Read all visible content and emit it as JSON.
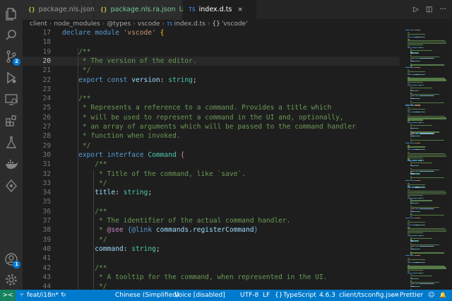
{
  "tabs": [
    {
      "icon": "{}",
      "label": "package.nls.json",
      "status": "",
      "active": false
    },
    {
      "icon": "{}",
      "label": "package.nls.ra.json",
      "status": "U",
      "active": false
    },
    {
      "icon": "TS",
      "label": "index.d.ts",
      "status": "",
      "active": true
    }
  ],
  "tab_actions": {
    "run": "▷",
    "split": "◫",
    "more": "···",
    "close": "×"
  },
  "breadcrumb": {
    "items": [
      "client",
      "node_modules",
      "@types",
      "vscode"
    ],
    "file_icon": "TS",
    "file": "index.d.ts",
    "symbol_icon": "{}",
    "symbol": "'vscode'"
  },
  "activity_bar": {
    "items": [
      {
        "icon": "files-icon"
      },
      {
        "icon": "search-icon"
      },
      {
        "icon": "source-control-icon",
        "badge": "2"
      },
      {
        "icon": "run-debug-icon"
      },
      {
        "icon": "remote-explorer-icon"
      },
      {
        "icon": "extensions-icon"
      },
      {
        "icon": "testing-icon"
      },
      {
        "icon": "docker-icon"
      },
      {
        "icon": "gitlens-icon"
      }
    ],
    "bottom": [
      {
        "icon": "account-icon",
        "badge": "1"
      },
      {
        "icon": "settings-gear-icon"
      }
    ]
  },
  "editor": {
    "current_line": "20",
    "lines": [
      {
        "n": "17",
        "tokens": [
          [
            "kw",
            "declare"
          ],
          [
            "pl",
            " "
          ],
          [
            "kw",
            "module"
          ],
          [
            "pl",
            " "
          ],
          [
            "str",
            "'vscode'"
          ],
          [
            "pl",
            " "
          ],
          [
            "br1",
            "{"
          ]
        ]
      },
      {
        "n": "18",
        "tokens": []
      },
      {
        "n": "19",
        "tokens": [
          [
            "pl",
            "    "
          ],
          [
            "cm",
            "/**"
          ]
        ]
      },
      {
        "n": "20",
        "tokens": [
          [
            "pl",
            "    "
          ],
          [
            "cm",
            " * The version of the editor."
          ]
        ]
      },
      {
        "n": "21",
        "tokens": [
          [
            "pl",
            "    "
          ],
          [
            "cm",
            " */"
          ]
        ]
      },
      {
        "n": "22",
        "tokens": [
          [
            "pl",
            "    "
          ],
          [
            "kw",
            "export"
          ],
          [
            "pl",
            " "
          ],
          [
            "kw",
            "const"
          ],
          [
            "pl",
            " "
          ],
          [
            "var",
            "version"
          ],
          [
            "pl",
            ": "
          ],
          [
            "ty",
            "string"
          ],
          [
            "pl",
            ";"
          ]
        ]
      },
      {
        "n": "23",
        "tokens": []
      },
      {
        "n": "24",
        "tokens": [
          [
            "pl",
            "    "
          ],
          [
            "cm",
            "/**"
          ]
        ]
      },
      {
        "n": "25",
        "tokens": [
          [
            "pl",
            "    "
          ],
          [
            "cm",
            " * Represents a reference to a command. Provides a title which"
          ]
        ]
      },
      {
        "n": "26",
        "tokens": [
          [
            "pl",
            "    "
          ],
          [
            "cm",
            " * will be used to represent a command in the UI and, optionally,"
          ]
        ]
      },
      {
        "n": "27",
        "tokens": [
          [
            "pl",
            "    "
          ],
          [
            "cm",
            " * an array of arguments which will be passed to the command handler"
          ]
        ]
      },
      {
        "n": "28",
        "tokens": [
          [
            "pl",
            "    "
          ],
          [
            "cm",
            " * function when invoked."
          ]
        ]
      },
      {
        "n": "29",
        "tokens": [
          [
            "pl",
            "    "
          ],
          [
            "cm",
            " */"
          ]
        ]
      },
      {
        "n": "30",
        "tokens": [
          [
            "pl",
            "    "
          ],
          [
            "kw",
            "export"
          ],
          [
            "pl",
            " "
          ],
          [
            "kw",
            "interface"
          ],
          [
            "pl",
            " "
          ],
          [
            "ty",
            "Command"
          ],
          [
            "pl",
            " "
          ],
          [
            "kw2",
            "{"
          ]
        ]
      },
      {
        "n": "31",
        "tokens": [
          [
            "pl",
            "        "
          ],
          [
            "cm",
            "/**"
          ]
        ]
      },
      {
        "n": "32",
        "tokens": [
          [
            "pl",
            "        "
          ],
          [
            "cm",
            " * Title of the command, like `save`."
          ]
        ]
      },
      {
        "n": "33",
        "tokens": [
          [
            "pl",
            "        "
          ],
          [
            "cm",
            " */"
          ]
        ]
      },
      {
        "n": "34",
        "tokens": [
          [
            "pl",
            "        "
          ],
          [
            "var",
            "title"
          ],
          [
            "pl",
            ": "
          ],
          [
            "ty",
            "string"
          ],
          [
            "pl",
            ";"
          ]
        ]
      },
      {
        "n": "35",
        "tokens": []
      },
      {
        "n": "36",
        "tokens": [
          [
            "pl",
            "        "
          ],
          [
            "cm",
            "/**"
          ]
        ]
      },
      {
        "n": "37",
        "tokens": [
          [
            "pl",
            "        "
          ],
          [
            "cm",
            " * The identifier of the actual command handler."
          ]
        ]
      },
      {
        "n": "38",
        "tokens": [
          [
            "pl",
            "        "
          ],
          [
            "cm",
            " * "
          ],
          [
            "kw2",
            "@see"
          ],
          [
            "pl",
            " "
          ],
          [
            "kw",
            "{@link"
          ],
          [
            "pl",
            " "
          ],
          [
            "var",
            "commands.registerCommand"
          ],
          [
            "kw",
            "}"
          ]
        ]
      },
      {
        "n": "39",
        "tokens": [
          [
            "pl",
            "        "
          ],
          [
            "cm",
            " */"
          ]
        ]
      },
      {
        "n": "40",
        "tokens": [
          [
            "pl",
            "        "
          ],
          [
            "var",
            "command"
          ],
          [
            "pl",
            ": "
          ],
          [
            "ty",
            "string"
          ],
          [
            "pl",
            ";"
          ]
        ]
      },
      {
        "n": "41",
        "tokens": []
      },
      {
        "n": "42",
        "tokens": [
          [
            "pl",
            "        "
          ],
          [
            "cm",
            "/**"
          ]
        ]
      },
      {
        "n": "43",
        "tokens": [
          [
            "pl",
            "        "
          ],
          [
            "cm",
            " * A tooltip for the command, when represented in the UI."
          ]
        ]
      },
      {
        "n": "44",
        "tokens": [
          [
            "pl",
            "        "
          ],
          [
            "cm",
            " */"
          ]
        ]
      }
    ]
  },
  "status_bar": {
    "remote_icon": "><",
    "branch_icon": "⑂",
    "branch": "feat/i18n*",
    "sync_icon": "↻",
    "locale": "Chinese (Simplified)",
    "voice": "Voice [disabled]",
    "encoding": "UTF-8",
    "eol": "LF",
    "lang_icon": "{}",
    "language": "TypeScript",
    "ts_version": "4.6.3",
    "tsconfig": "client/tsconfig.json",
    "prettier_icon": "✓✓",
    "prettier": "Prettier",
    "feedback_icon": "☺",
    "bell_icon": "🔔"
  },
  "colors": {
    "status_bg": "#007acc",
    "remote_bg": "#16825d",
    "comment": "#6a9955",
    "keyword": "#569cd6",
    "string": "#ce9178",
    "type": "#4ec9b0",
    "variable": "#9cdcfe"
  }
}
